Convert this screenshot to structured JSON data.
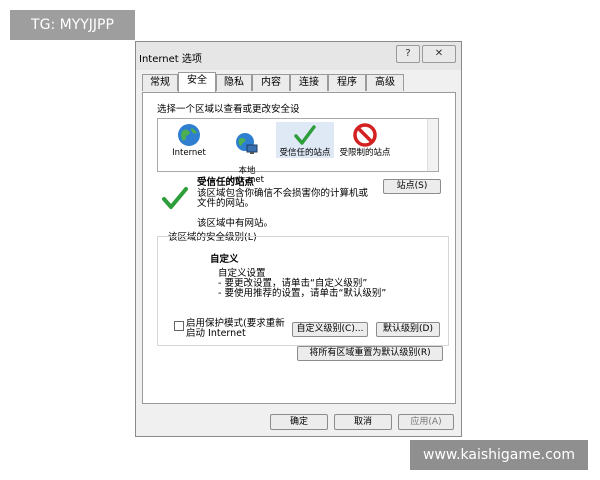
{
  "watermarks": {
    "top": "TG: MYYJJPP",
    "bottom": "www.kaishigame.com"
  },
  "window": {
    "title": "Internet 选项",
    "help_label": "?",
    "close_label": "✕"
  },
  "tabs": [
    "常规",
    "安全",
    "隐私",
    "内容",
    "连接",
    "程序",
    "高级"
  ],
  "active_tab": "安全",
  "security": {
    "select_prompt": "选择一个区域以查看或更改安全设",
    "zones": [
      {
        "label": "Internet",
        "icon": "globe-icon"
      },
      {
        "label": "本地\nIntranet",
        "icon": "local-intranet-icon"
      },
      {
        "label": "受信任的站点",
        "icon": "trusted-sites-check-icon"
      },
      {
        "label": "受限制的站点",
        "icon": "restricted-sites-icon"
      }
    ],
    "selected_zone_title": "受信任的站点",
    "sites_button": "站点(S)",
    "description": "该区域包含你确信不会损害你的计算机或文件的网站。",
    "has_sites": "该区域中有网站。",
    "level_group_label": "该区域的安全级别(L)",
    "level_title": "自定义",
    "level_lines": [
      "自定义设置",
      "- 要更改设置，请单击“自定义级别”",
      "- 要使用推荐的设置，请单击“默认级别”"
    ],
    "protected_mode": "启用保护模式(要求重新启动 Internet",
    "custom_level_button": "自定义级别(C)...",
    "default_level_button": "默认级别(D)",
    "reset_all_button": "将所有区域重置为默认级别(R)"
  },
  "footer": {
    "ok": "确定",
    "cancel": "取消",
    "apply": "应用(A)"
  }
}
